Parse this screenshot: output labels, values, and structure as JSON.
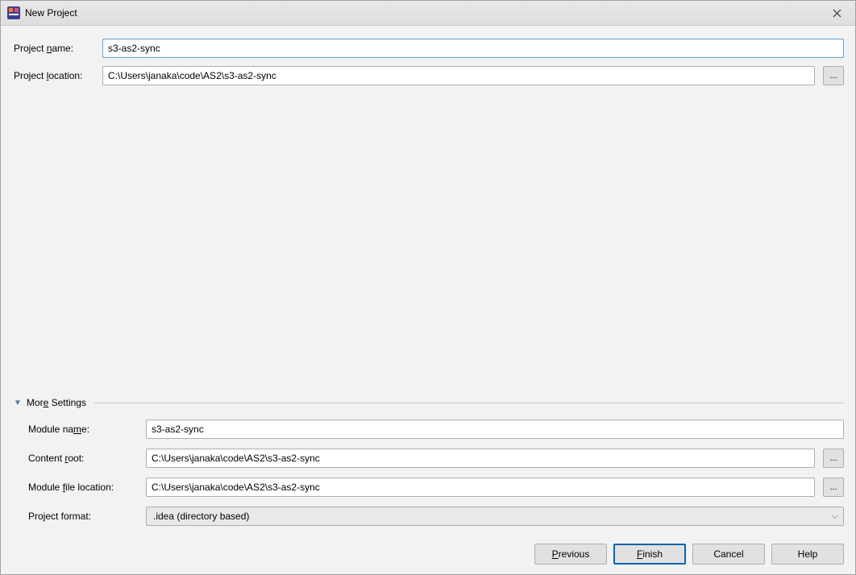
{
  "window": {
    "title": "New Project"
  },
  "form": {
    "project_name_label": "Project name:",
    "project_name_value": "s3-as2-sync",
    "project_location_label": "Project location:",
    "project_location_value": "C:\\Users\\janaka\\code\\AS2\\s3-as2-sync",
    "browse_glyph": "..."
  },
  "more": {
    "header": "More Settings",
    "module_name_label": "Module name:",
    "module_name_value": "s3-as2-sync",
    "content_root_label": "Content root:",
    "content_root_value": "C:\\Users\\janaka\\code\\AS2\\s3-as2-sync",
    "module_file_loc_label": "Module file location:",
    "module_file_loc_value": "C:\\Users\\janaka\\code\\AS2\\s3-as2-sync",
    "project_format_label": "Project format:",
    "project_format_value": ".idea (directory based)",
    "browse_glyph_1": "...",
    "browse_glyph_2": "..."
  },
  "buttons": {
    "previous": "Previous",
    "finish": "Finish",
    "cancel": "Cancel",
    "help": "Help"
  }
}
